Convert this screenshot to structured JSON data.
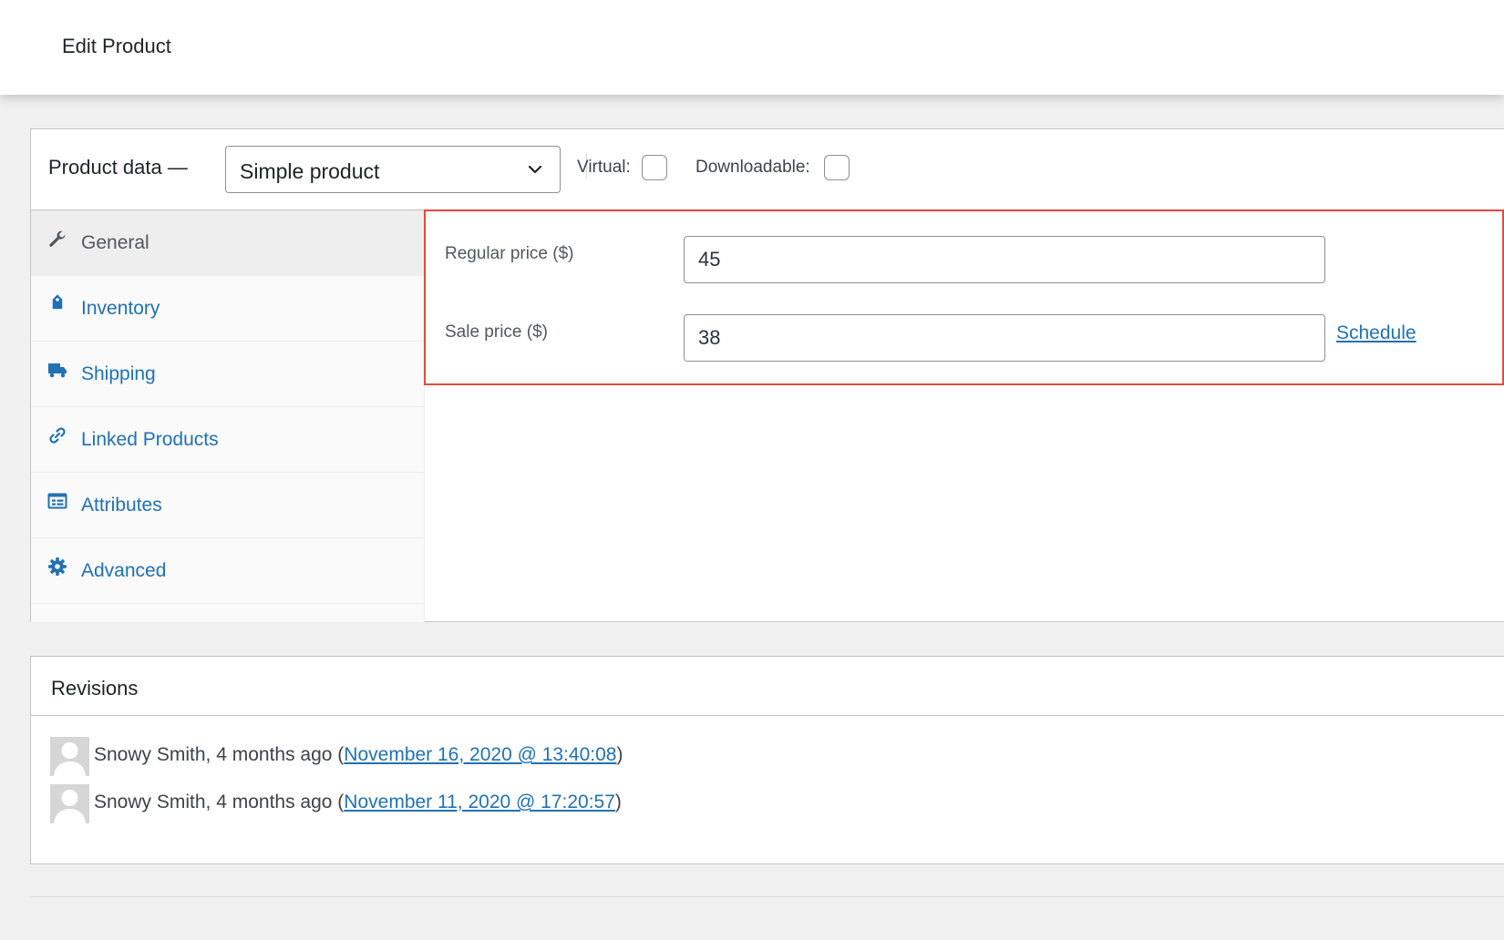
{
  "header": {
    "title": "Edit Product"
  },
  "product_data": {
    "title": "Product data —",
    "type_select": {
      "value": "Simple product"
    },
    "virtual_label": "Virtual:",
    "downloadable_label": "Downloadable:",
    "virtual_checked": false,
    "downloadable_checked": false
  },
  "tabs": [
    {
      "label": "General",
      "icon": "wrench-icon",
      "active": true
    },
    {
      "label": "Inventory",
      "icon": "tag-icon",
      "active": false
    },
    {
      "label": "Shipping",
      "icon": "truck-icon",
      "active": false
    },
    {
      "label": "Linked Products",
      "icon": "link-icon",
      "active": false
    },
    {
      "label": "Attributes",
      "icon": "list-card-icon",
      "active": false
    },
    {
      "label": "Advanced",
      "icon": "gear-icon",
      "active": false
    }
  ],
  "general": {
    "regular_price_label": "Regular price ($)",
    "regular_price_value": "45",
    "sale_price_label": "Sale price ($)",
    "sale_price_value": "38",
    "schedule_label": "Schedule"
  },
  "revisions": {
    "title": "Revisions",
    "items": [
      {
        "author_text": "Snowy Smith, 4 months ago (",
        "date_link": "November 16, 2020 @ 13:40:08",
        "suffix": ")"
      },
      {
        "author_text": "Snowy Smith, 4 months ago (",
        "date_link": "November 11, 2020 @ 17:20:57",
        "suffix": ")"
      }
    ]
  },
  "colors": {
    "link": "#2271b1",
    "highlight_border": "#e24c3b",
    "page_background": "#f0f0f1"
  }
}
